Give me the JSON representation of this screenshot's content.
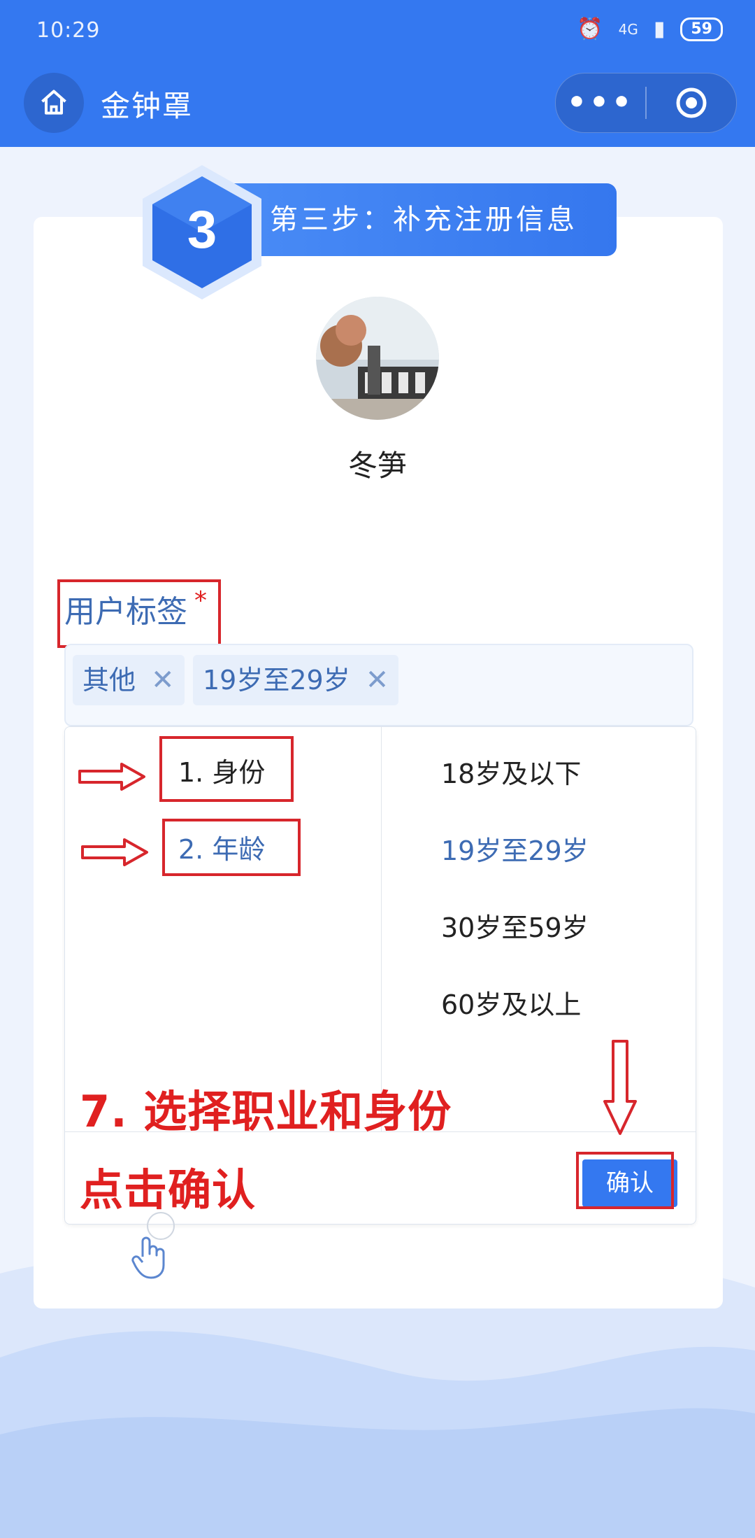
{
  "status_bar": {
    "time": "10:29",
    "network": "4G",
    "battery": "59"
  },
  "header": {
    "title": "金钟罩",
    "more_label": "•••"
  },
  "step": {
    "number": "3",
    "title": "第三步：补充注册信息"
  },
  "profile": {
    "name": "冬笋"
  },
  "tags": {
    "label": "用户标签",
    "required_mark": "*",
    "chips": [
      {
        "label": "其他"
      },
      {
        "label": "19岁至29岁"
      }
    ],
    "remove_symbol": "✕"
  },
  "picker": {
    "categories": [
      {
        "label": "1. 身份"
      },
      {
        "label": "2. 年龄"
      }
    ],
    "options": [
      {
        "label": "18岁及以下"
      },
      {
        "label": "19岁至29岁"
      },
      {
        "label": "30岁至59岁"
      },
      {
        "label": "60岁及以上"
      }
    ],
    "confirm_label": "确认"
  },
  "annotation": {
    "line1": "7. 选择职业和身份",
    "line2": "点击确认"
  },
  "colors": {
    "brand": "#3478f0",
    "annotation": "#e02020",
    "selected": "#3d6bb3"
  },
  "icons": [
    "home-icon",
    "more-icon",
    "target-icon",
    "close-icon",
    "arrow-right-icon",
    "arrow-down-icon",
    "hand-pointer-icon",
    "hexagon-step-icon"
  ]
}
